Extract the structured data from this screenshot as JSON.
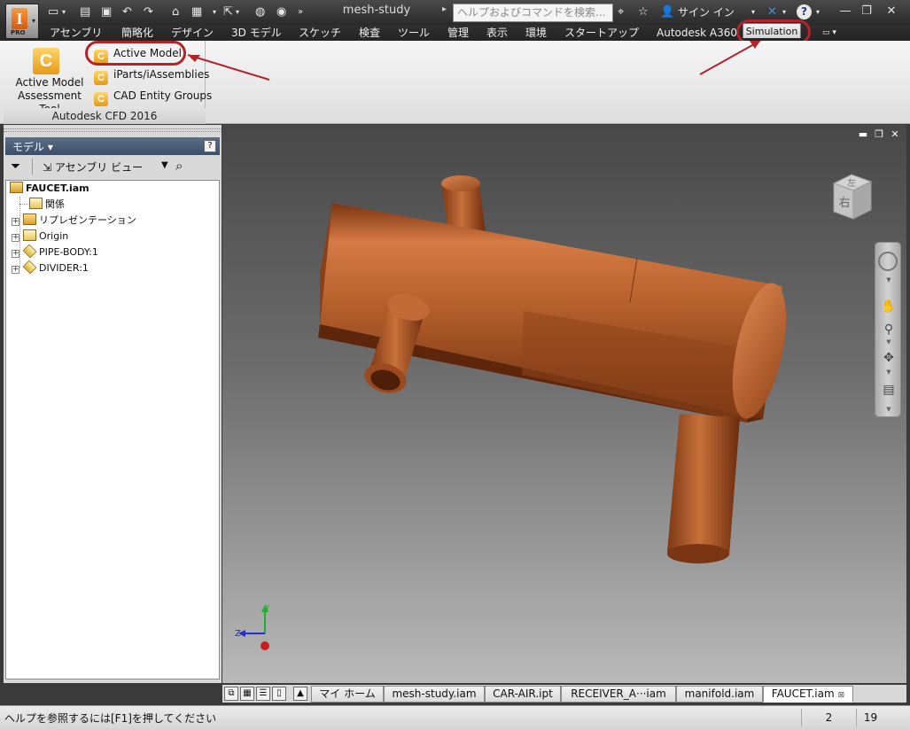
{
  "titlebar": {
    "document_title": "mesh-study",
    "search_placeholder": "ヘルプおよびコマンドを検索...",
    "sign_in": "サイン イン",
    "app_badge": "PRO",
    "app_letter": "I"
  },
  "menu": {
    "tabs": [
      "アセンブリ",
      "簡略化",
      "デザイン",
      "3D モデル",
      "スケッチ",
      "検査",
      "ツール",
      "管理",
      "表示",
      "環境",
      "スタートアップ",
      "Autodesk A360"
    ],
    "active_tab": "Simulation"
  },
  "ribbon": {
    "big_button_label": "Active Model\nAssessment Tool",
    "small_buttons": [
      "Active Model",
      "iParts/iAssemblies",
      "CAD Entity Groups"
    ],
    "panel_title": "Autodesk CFD 2016"
  },
  "browser": {
    "title": "モデル ▾",
    "view_label": "アセンブリ ビュー",
    "tree": [
      {
        "label": "FAUCET.iam",
        "icon": "assembly-icon",
        "bold": true
      },
      {
        "label": "関係",
        "icon": "folder-icon"
      },
      {
        "label": "リプレゼンテーション",
        "icon": "representation-icon"
      },
      {
        "label": "Origin",
        "icon": "folder-icon"
      },
      {
        "label": "PIPE-BODY:1",
        "icon": "part-icon"
      },
      {
        "label": "DIVIDER:1",
        "icon": "part-icon"
      }
    ]
  },
  "viewcube": {
    "face_top": "左",
    "face_front": "右"
  },
  "triad": {
    "axis_z": "Z",
    "axis_y": "Y"
  },
  "doc_tabs": [
    "マイ ホーム",
    "mesh-study.iam",
    "CAR-AIR.ipt",
    "RECEIVER_A···iam",
    "manifold.iam",
    "FAUCET.iam"
  ],
  "active_doc_tab": "FAUCET.iam",
  "status": {
    "help_text": "ヘルプを参照するには[F1]を押してください",
    "count_a": "2",
    "count_b": "19"
  },
  "colors": {
    "model_copper": "#b8622e",
    "highlight_ring": "#b3242a",
    "cfd_icon": "#e69a14"
  }
}
